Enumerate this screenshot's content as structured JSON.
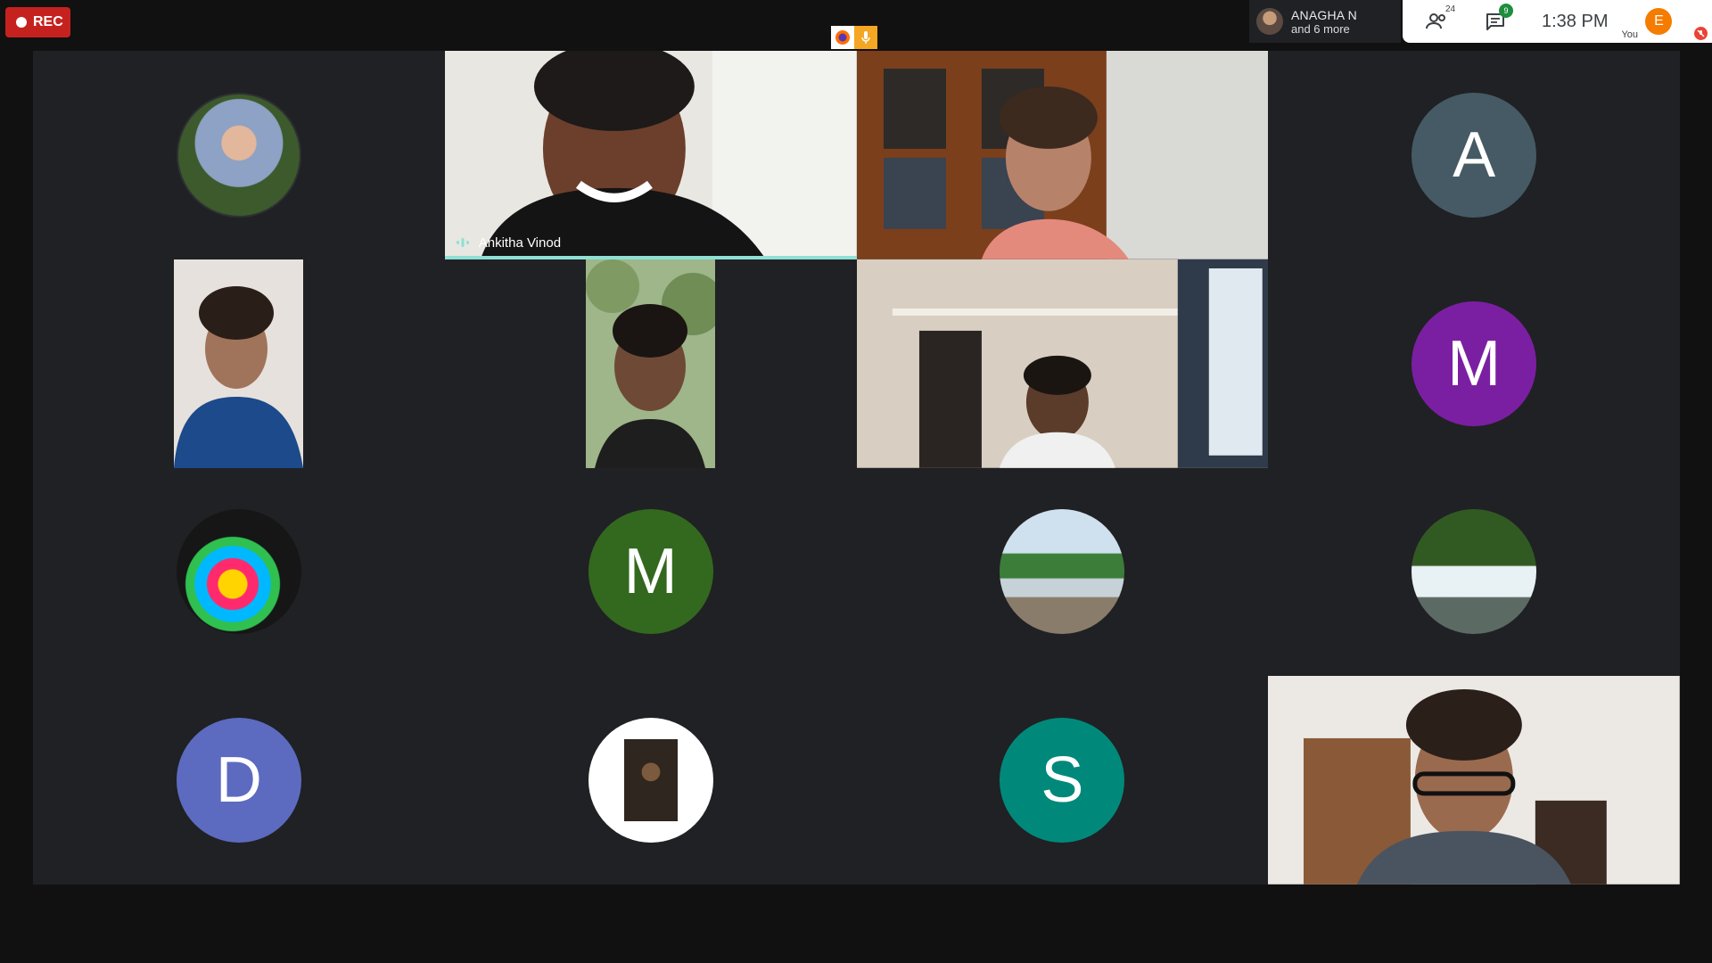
{
  "recording": {
    "label": "REC"
  },
  "presenter": {
    "name": "ANAGHA N",
    "subtitle": "and 6 more"
  },
  "toolbar": {
    "participants_count": "24",
    "chat_badge": "9",
    "time": "1:38  PM",
    "self_initial": "E",
    "self_label": "You",
    "self_color": "#f57c00"
  },
  "tiles": [
    {
      "kind": "photo-avatar",
      "icon": "hijab-portrait"
    },
    {
      "kind": "video",
      "name": "Ankitha Vinod",
      "speaking": true
    },
    {
      "kind": "video"
    },
    {
      "kind": "initial",
      "letter": "A",
      "color": "#455a64"
    },
    {
      "kind": "video-portrait"
    },
    {
      "kind": "video-portrait"
    },
    {
      "kind": "video"
    },
    {
      "kind": "initial",
      "letter": "M",
      "color": "#7b1fa2"
    },
    {
      "kind": "photo-avatar",
      "icon": "paint-splash"
    },
    {
      "kind": "initial",
      "letter": "M",
      "color": "#33691e"
    },
    {
      "kind": "photo-avatar",
      "icon": "beach"
    },
    {
      "kind": "photo-avatar",
      "icon": "waterfall"
    },
    {
      "kind": "initial",
      "letter": "D",
      "color": "#5c6bc0"
    },
    {
      "kind": "photo-avatar",
      "icon": "dark-portrait"
    },
    {
      "kind": "initial",
      "letter": "S",
      "color": "#00897b"
    },
    {
      "kind": "video"
    }
  ]
}
